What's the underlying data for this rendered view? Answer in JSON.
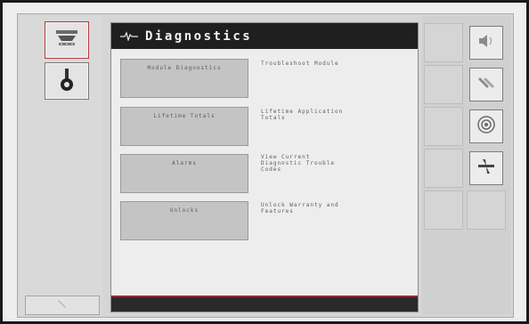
{
  "header": {
    "title": "Diagnostics",
    "pulse_icon": "heartbeat-icon"
  },
  "left_column": {
    "buttons": [
      {
        "icon": "implement-icon",
        "active": true
      },
      {
        "icon": "gauge-icon",
        "active": false
      }
    ],
    "bottom_icon": "wrench-icon"
  },
  "menu": [
    {
      "label": "Module Diagnostics",
      "description": "Troubleshoot Module"
    },
    {
      "label": "Lifetime Totals",
      "description": "Lifetime Application\nTotals"
    },
    {
      "label": "Alarms",
      "description": "View Current\nDiagnostic Trouble\nCodes"
    },
    {
      "label": "Unlocks",
      "description": "Unlock Warranty and\nFeatures"
    }
  ],
  "softkeys": [
    {
      "icon": "speaker-icon"
    },
    {
      "icon": "link-icon"
    },
    {
      "icon": "sensor-icon"
    },
    {
      "icon": "fan-icon"
    }
  ],
  "colors": {
    "title_bar": "#1f1f1f",
    "accent": "#b53a3a",
    "button": "#c4c4c4"
  }
}
